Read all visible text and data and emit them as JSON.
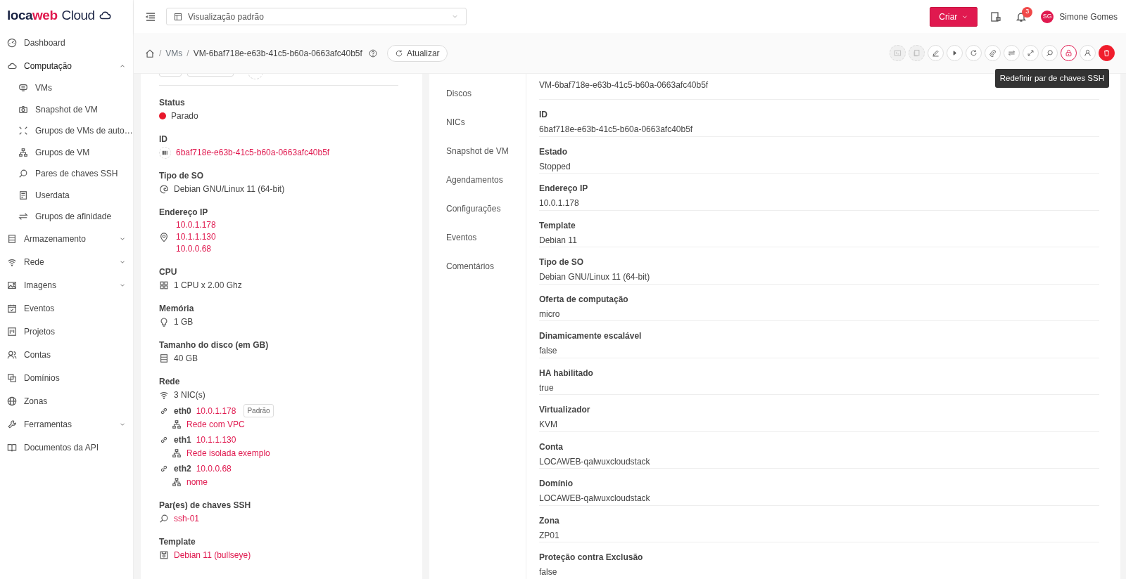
{
  "brand": {
    "name_part1": "loca",
    "name_part2": "web",
    "name_part3": "Cloud"
  },
  "sidebar": {
    "items": [
      {
        "label": "Dashboard"
      },
      {
        "label": "Computação",
        "expanded": true,
        "children": [
          {
            "label": "VMs"
          },
          {
            "label": "Snapshot de VM"
          },
          {
            "label": "Grupos de VMs de auto…"
          },
          {
            "label": "Grupos de VM"
          },
          {
            "label": "Pares de chaves SSH"
          },
          {
            "label": "Userdata"
          },
          {
            "label": "Grupos de afinidade"
          }
        ]
      },
      {
        "label": "Armazenamento",
        "expanded": false
      },
      {
        "label": "Rede",
        "expanded": false
      },
      {
        "label": "Imagens",
        "expanded": false
      },
      {
        "label": "Eventos"
      },
      {
        "label": "Projetos"
      },
      {
        "label": "Contas"
      },
      {
        "label": "Domínios"
      },
      {
        "label": "Zonas"
      },
      {
        "label": "Ferramentas",
        "expanded": false
      },
      {
        "label": "Documentos da API"
      }
    ]
  },
  "header": {
    "view_select": "Visualização padrão",
    "create_button": "Criar",
    "notifications_count": "3",
    "user_initials": "SG",
    "user_name": "Simone Gomes"
  },
  "breadcrumb": {
    "separator": "/",
    "items": [
      "VMs",
      "VM-6baf718e-e63b-41c5-b60a-0663afc40b5f"
    ],
    "refresh_button": "Atualizar"
  },
  "actions": [
    {
      "disabled": true,
      "highlighted": false,
      "kind": "default"
    },
    {
      "disabled": true,
      "highlighted": false,
      "kind": "default"
    },
    {
      "disabled": false,
      "highlighted": false,
      "kind": "default"
    },
    {
      "disabled": false,
      "highlighted": false,
      "kind": "default"
    },
    {
      "disabled": false,
      "highlighted": false,
      "kind": "default"
    },
    {
      "disabled": false,
      "highlighted": false,
      "kind": "default"
    },
    {
      "disabled": false,
      "highlighted": false,
      "kind": "default"
    },
    {
      "disabled": false,
      "highlighted": false,
      "kind": "default"
    },
    {
      "disabled": false,
      "highlighted": false,
      "kind": "default"
    },
    {
      "disabled": false,
      "highlighted": true,
      "kind": "default",
      "tooltip": "Redefinir par de chaves SSH"
    },
    {
      "disabled": false,
      "highlighted": false,
      "kind": "default"
    },
    {
      "disabled": false,
      "highlighted": false,
      "kind": "danger"
    }
  ],
  "info_card": {
    "fields": [
      {
        "kind": "status",
        "label": "Status",
        "value": "Parado",
        "color": "#e8192c"
      },
      {
        "kind": "link",
        "label": "ID",
        "value": "6baf718e-e63b-41c5-b60a-0663afc40b5f"
      },
      {
        "kind": "text",
        "label": "Tipo de SO",
        "value": "Debian GNU/Linux 11 (64-bit)"
      },
      {
        "kind": "links",
        "label": "Endereço IP",
        "values": [
          "10.0.1.178",
          "10.1.1.130",
          "10.0.0.68"
        ]
      },
      {
        "kind": "text",
        "label": "CPU",
        "value": "1 CPU x 2.00 Ghz"
      },
      {
        "kind": "text",
        "label": "Memória",
        "value": "1 GB"
      },
      {
        "kind": "text",
        "label": "Tamanho do disco (em GB)",
        "value": "40 GB"
      },
      {
        "kind": "network",
        "label": "Rede",
        "value": "3 NIC(s)",
        "nics": [
          {
            "name": "eth0",
            "ip": "10.0.1.178",
            "badge": "Padrão",
            "network": "Rede com VPC"
          },
          {
            "name": "eth1",
            "ip": "10.1.1.130",
            "network": "Rede isolada exemplo"
          },
          {
            "name": "eth2",
            "ip": "10.0.0.68",
            "network": "nome"
          }
        ]
      },
      {
        "kind": "link",
        "label": "Par(es) de chaves SSH",
        "value": "ssh-01"
      },
      {
        "kind": "link",
        "label": "Template",
        "value": "Debian 11 (bullseye)"
      }
    ]
  },
  "tabs": [
    {
      "label": "Discos",
      "selected": false
    },
    {
      "label": "NICs",
      "selected": false
    },
    {
      "label": "Snapshot de VM",
      "selected": false
    },
    {
      "label": "Agendamentos",
      "selected": false
    },
    {
      "label": "Configurações",
      "selected": false
    },
    {
      "label": "Eventos",
      "selected": false
    },
    {
      "label": "Comentários",
      "selected": false
    }
  ],
  "details": [
    {
      "value": "VM-6baf718e-e63b-41c5-b60a-0663afc40b5f"
    },
    {
      "label": "ID",
      "value": "6baf718e-e63b-41c5-b60a-0663afc40b5f"
    },
    {
      "label": "Estado",
      "value": "Stopped"
    },
    {
      "label": "Endereço IP",
      "value": "10.0.1.178"
    },
    {
      "label": "Template",
      "value": "Debian 11"
    },
    {
      "label": "Tipo de SO",
      "value": "Debian GNU/Linux 11 (64-bit)"
    },
    {
      "label": "Oferta de computação",
      "value": "micro"
    },
    {
      "label": "Dinamicamente escalável",
      "value": "false"
    },
    {
      "label": "HA habilitado",
      "value": "true"
    },
    {
      "label": "Virtualizador",
      "value": "KVM"
    },
    {
      "label": "Conta",
      "value": "LOCAWEB-qalwuxcloudstack"
    },
    {
      "label": "Domínio",
      "value": "LOCAWEB-qalwuxcloudstack"
    },
    {
      "label": "Zona",
      "value": "ZP01"
    },
    {
      "label": "Proteção contra Exclusão",
      "value": "false"
    }
  ]
}
